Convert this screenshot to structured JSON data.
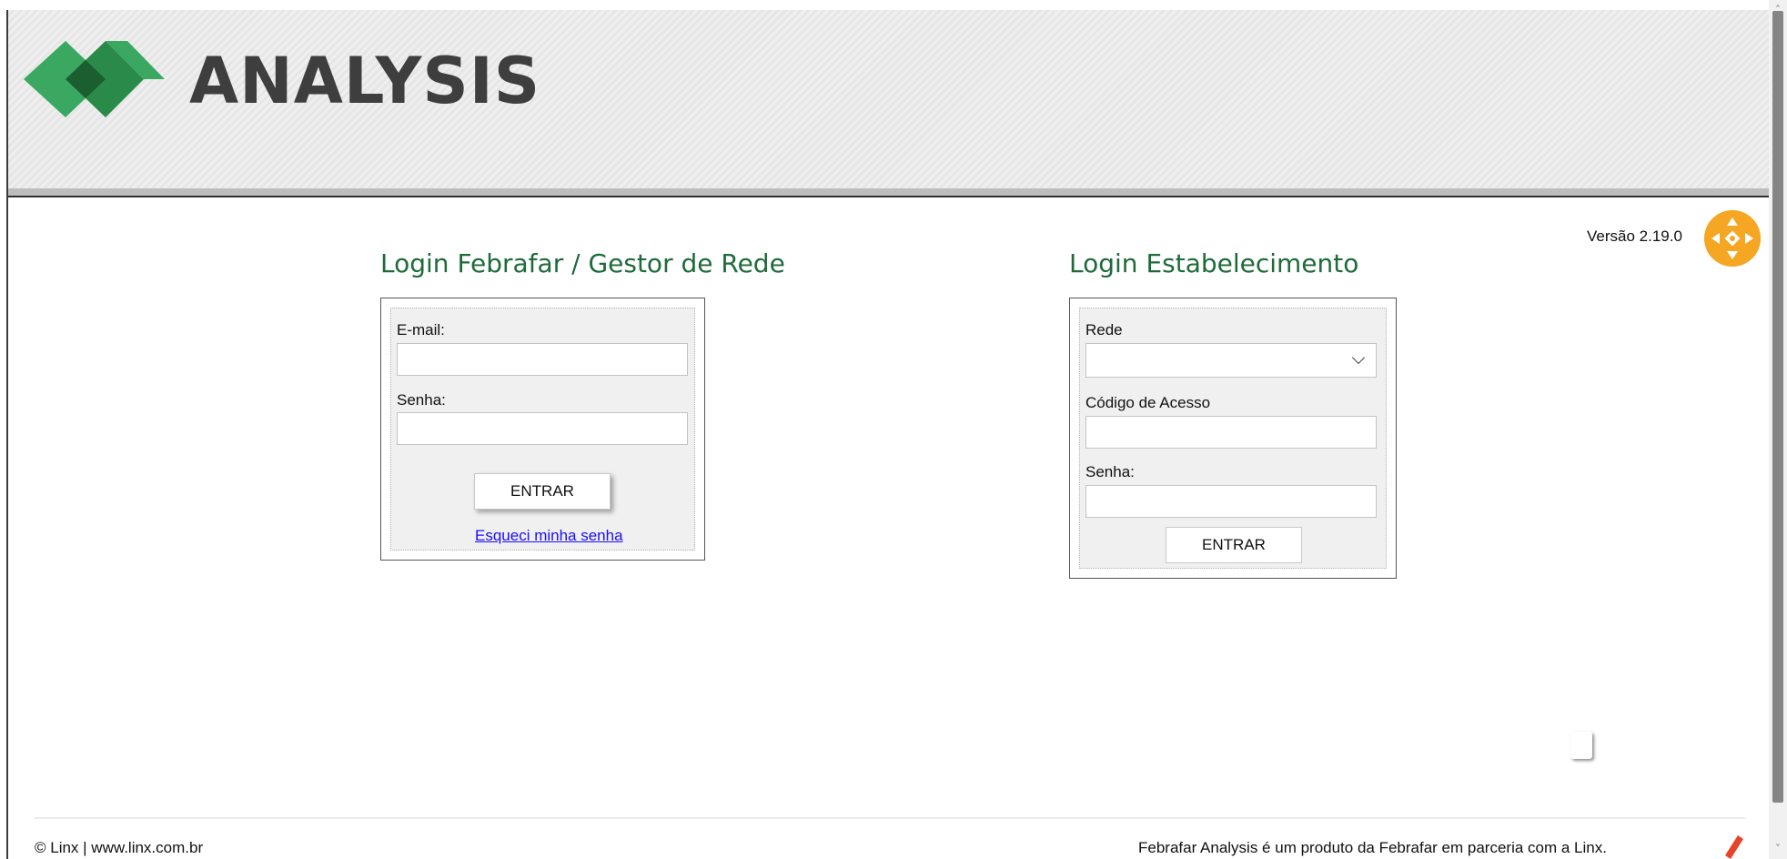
{
  "header": {
    "brand": "ANALYSIS",
    "logo_icon": "analysis-diamond-logo",
    "accent_color": "#1e6b3a"
  },
  "version_label": "Versão 2.19.0",
  "nav_icon": "orange-compass-icon",
  "login_gestor": {
    "title": "Login Febrafar / Gestor de Rede",
    "email_label": "E-mail:",
    "email_value": "",
    "password_label": "Senha:",
    "password_value": "",
    "submit_label": "ENTRAR",
    "forgot_link": "Esqueci minha senha"
  },
  "login_estabelecimento": {
    "title": "Login Estabelecimento",
    "rede_label": "Rede",
    "rede_selected": "",
    "codigo_label": "Código de Acesso",
    "codigo_value": "",
    "password_label": "Senha:",
    "password_value": "",
    "submit_label": "ENTRAR"
  },
  "footer": {
    "left": "© Linx | www.linx.com.br",
    "right": "Febrafar Analysis é um produto da Febrafar em parceria com a Linx."
  }
}
